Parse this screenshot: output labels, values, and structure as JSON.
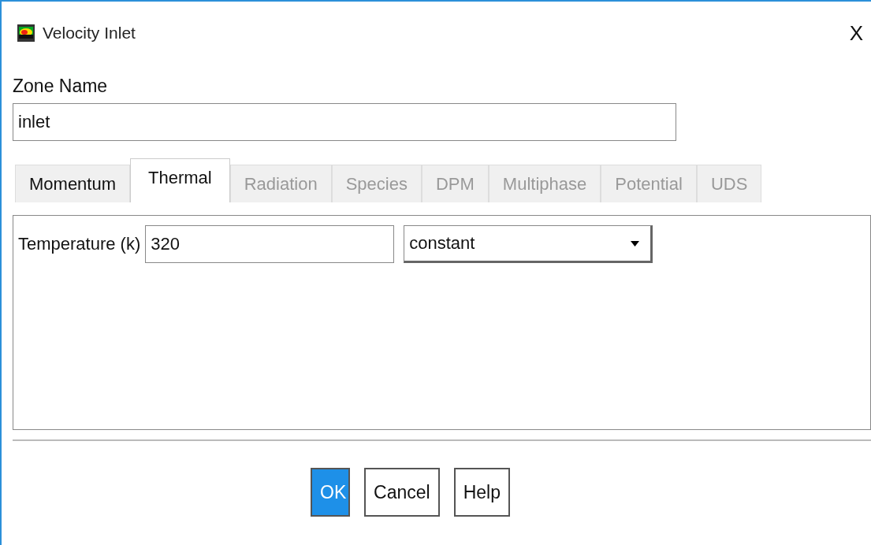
{
  "window": {
    "title": "Velocity Inlet",
    "close": "X"
  },
  "zone_name": {
    "label": "Zone Name",
    "value": "inlet"
  },
  "tabs": [
    {
      "label": "Momentum",
      "selected": false,
      "disabled": false
    },
    {
      "label": "Thermal",
      "selected": true,
      "disabled": false
    },
    {
      "label": "Radiation",
      "selected": false,
      "disabled": true
    },
    {
      "label": "Species",
      "selected": false,
      "disabled": true
    },
    {
      "label": "DPM",
      "selected": false,
      "disabled": true
    },
    {
      "label": "Multiphase",
      "selected": false,
      "disabled": true
    },
    {
      "label": "Potential",
      "selected": false,
      "disabled": true
    },
    {
      "label": "UDS",
      "selected": false,
      "disabled": true
    }
  ],
  "temperature": {
    "label": "Temperature (k)",
    "value": "320",
    "method": "constant"
  },
  "buttons": [
    {
      "label": "OK",
      "default": true
    },
    {
      "label": "Cancel",
      "default": false
    },
    {
      "label": "Help",
      "default": false
    }
  ]
}
